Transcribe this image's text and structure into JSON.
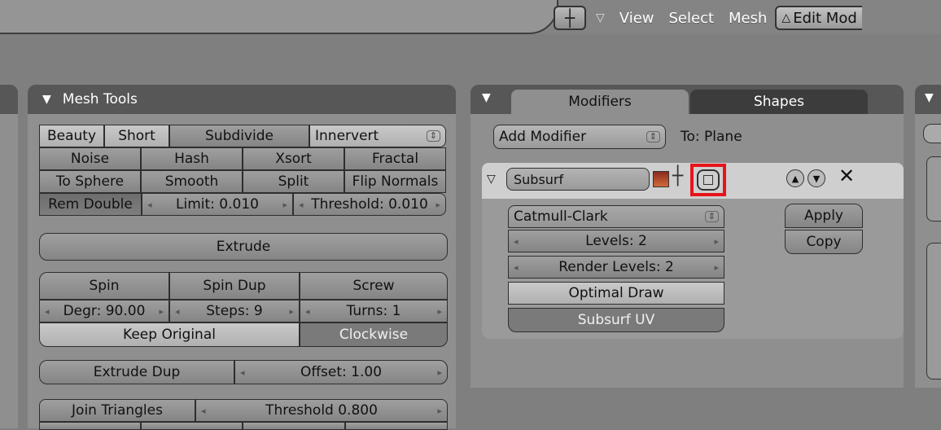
{
  "header": {
    "menus": [
      "View",
      "Select",
      "Mesh"
    ],
    "mode_label": "Edit Mod",
    "view_icon": "crosshair-icon"
  },
  "mesh_tools": {
    "title": "Mesh Tools",
    "row1": {
      "beauty": "Beauty",
      "short": "Short",
      "subdivide": "Subdivide",
      "innervert": "Innervert"
    },
    "row2": [
      "Noise",
      "Hash",
      "Xsort",
      "Fractal"
    ],
    "row3": [
      "To Sphere",
      "Smooth",
      "Split",
      "Flip Normals"
    ],
    "row4": {
      "rem_double": "Rem Double",
      "limit": "Limit: 0.010",
      "threshold": "Threshold: 0.010"
    },
    "extrude": "Extrude",
    "spin_row": [
      "Spin",
      "Spin Dup",
      "Screw"
    ],
    "params": {
      "degr": "Degr: 90.00",
      "steps": "Steps: 9",
      "turns": "Turns: 1"
    },
    "keep_original": "Keep Original",
    "clockwise": "Clockwise",
    "extrude_dup": "Extrude Dup",
    "offset": "Offset: 1.00",
    "join_triangles": "Join Triangles",
    "join_threshold": "Threshold 0.800"
  },
  "modifiers": {
    "tabs": [
      "Modifiers",
      "Shapes"
    ],
    "add_modifier": "Add Modifier",
    "target": "To: Plane",
    "modifier_name": "Subsurf",
    "subdivision_type": "Catmull-Clark",
    "levels": "Levels: 2",
    "render_levels": "Render Levels: 2",
    "optimal_draw": "Optimal Draw",
    "subsurf_uv": "Subsurf UV",
    "apply": "Apply",
    "copy": "Copy",
    "highlight_color": "#e8141b"
  }
}
